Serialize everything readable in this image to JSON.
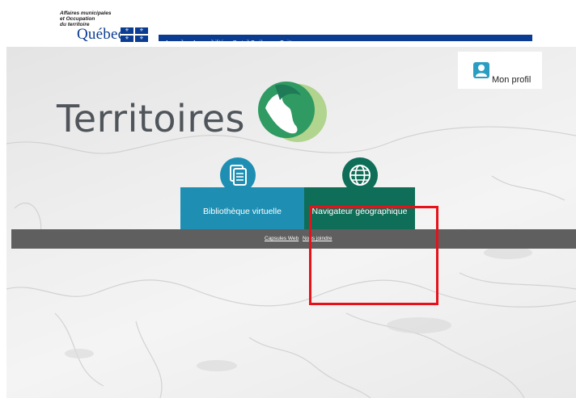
{
  "header": {
    "ministry_line1": "Affaires municipales",
    "ministry_line2": "et Occupation",
    "ministry_line3": "du territoire",
    "logo_text": "Québec",
    "brand_color": "#0a3d91",
    "nav": [
      {
        "label": "Accueil"
      },
      {
        "label": "Accessibilité"
      },
      {
        "label": "Portail Québec"
      },
      {
        "label": "Quitter"
      }
    ]
  },
  "profile": {
    "label": "Mon profil",
    "icon": "user-icon"
  },
  "hero": {
    "title": "Territoires",
    "logo_icon": "territoires-logo-icon"
  },
  "tiles": [
    {
      "label": "Bibliothèque virtuelle",
      "icon": "document-icon",
      "color": "#1e8fb3"
    },
    {
      "label": "Navigateur géographique",
      "icon": "globe-icon",
      "color": "#0e6e57"
    }
  ],
  "footer": {
    "links": [
      {
        "label": "Capsules Web"
      },
      {
        "label": "Nous joindre"
      }
    ]
  },
  "annotation": {
    "highlight_color": "#e5121a"
  }
}
